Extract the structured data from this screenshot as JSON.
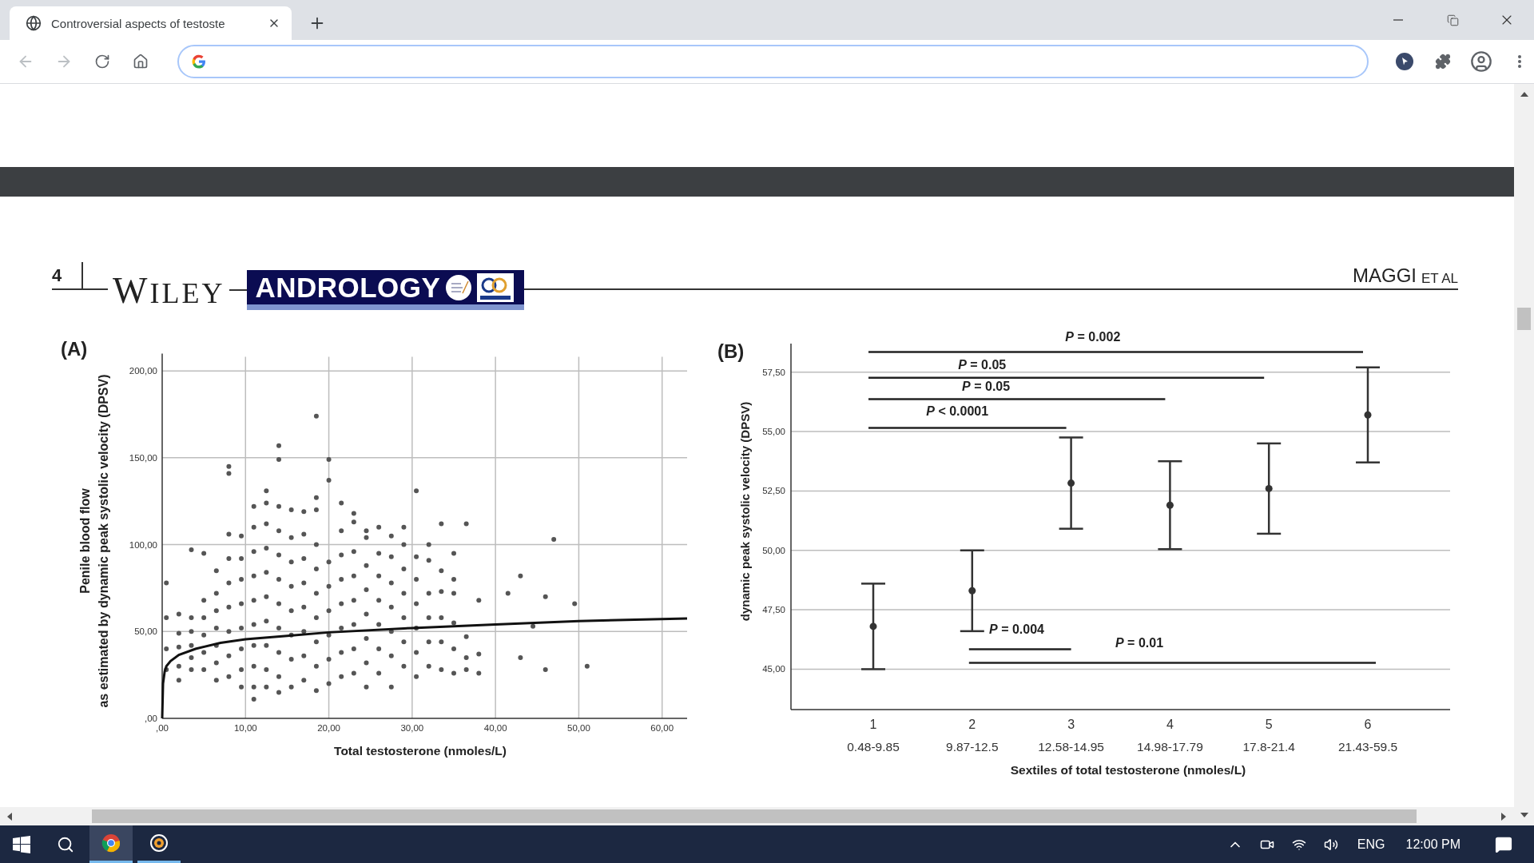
{
  "browser": {
    "tabs": [
      {
        "title": "Controversial aspects of testoste",
        "selected": true
      }
    ],
    "address_bar": {
      "focused": true
    }
  },
  "page": {
    "page_number": "4",
    "publisher": "WILEY",
    "journal": "ANDROLOGY",
    "author": "MAGGI",
    "author_suffix": "ET AL",
    "figures": [
      {
        "panel": "(A)",
        "chart_data": {
          "type": "scatter",
          "xlabel": "Total testosterone (nmoles/L)",
          "ylabel": [
            "Penile blood flow",
            "as estimated by dynamic peak systolic velocity (DPSV)"
          ],
          "xlim": [
            0,
            63
          ],
          "ylim": [
            0,
            210
          ],
          "grid": true,
          "xticks": [
            {
              "value": 0,
              "label": ",00"
            },
            {
              "value": 10,
              "label": "10,00"
            },
            {
              "value": 20,
              "label": "20,00"
            },
            {
              "value": 30,
              "label": "30,00"
            },
            {
              "value": 40,
              "label": "40,00"
            },
            {
              "value": 50,
              "label": "50,00"
            },
            {
              "value": 60,
              "label": "60,00"
            }
          ],
          "yticks": [
            {
              "value": 0,
              "label": ",00"
            },
            {
              "value": 50,
              "label": "50,00"
            },
            {
              "value": 100,
              "label": "100,00"
            },
            {
              "value": 150,
              "label": "150,00"
            },
            {
              "value": 200,
              "label": "200,00"
            }
          ],
          "x": [
            0.5,
            0.5,
            0.5,
            0.5,
            2,
            2,
            2,
            2,
            2,
            3.5,
            3.5,
            3.5,
            3.5,
            3.5,
            3.5,
            5,
            5,
            5,
            5,
            5,
            5,
            6.5,
            6.5,
            6.5,
            6.5,
            6.5,
            6.5,
            6.5,
            8,
            8,
            8,
            8,
            8,
            8,
            8,
            8,
            8,
            9.5,
            9.5,
            9.5,
            9.5,
            9.5,
            9.5,
            9.5,
            9.5,
            11,
            11,
            11,
            11,
            11,
            11,
            11,
            11,
            11,
            11,
            12.5,
            12.5,
            12.5,
            12.5,
            12.5,
            12.5,
            12.5,
            12.5,
            12.5,
            12.5,
            14,
            14,
            14,
            14,
            14,
            14,
            14,
            14,
            14,
            14,
            14,
            15.5,
            15.5,
            15.5,
            15.5,
            15.5,
            15.5,
            15.5,
            15.5,
            17,
            17,
            17,
            17,
            17,
            17,
            17,
            17,
            18.5,
            18.5,
            18.5,
            18.5,
            18.5,
            18.5,
            18.5,
            18.5,
            18.5,
            18.5,
            20,
            20,
            20,
            20,
            20,
            20,
            20,
            20,
            21.5,
            21.5,
            21.5,
            21.5,
            21.5,
            21.5,
            21.5,
            21.5,
            23,
            23,
            23,
            23,
            23,
            23,
            23,
            23,
            24.5,
            24.5,
            24.5,
            24.5,
            24.5,
            24.5,
            24.5,
            24.5,
            26,
            26,
            26,
            26,
            26,
            26,
            26,
            27.5,
            27.5,
            27.5,
            27.5,
            27.5,
            27.5,
            27.5,
            29,
            29,
            29,
            29,
            29,
            29,
            29,
            30.5,
            30.5,
            30.5,
            30.5,
            30.5,
            30.5,
            30.5,
            32,
            32,
            32,
            32,
            32,
            32,
            33.5,
            33.5,
            33.5,
            33.5,
            33.5,
            33.5,
            35,
            35,
            35,
            35,
            35,
            35,
            36.5,
            36.5,
            36.5,
            36.5,
            38,
            38,
            38,
            41.5,
            43,
            43,
            44.5,
            46,
            46,
            47,
            49.5,
            51
          ],
          "series": [
            {
              "color": "#555555",
              "values": [
                78,
                58,
                40,
                28,
                60,
                49,
                41,
                30,
                22,
                97,
                58,
                50,
                42,
                35,
                28,
                95,
                68,
                58,
                48,
                38,
                28,
                85,
                72,
                62,
                52,
                42,
                32,
                22,
                145,
                141,
                106,
                92,
                78,
                64,
                50,
                36,
                24,
                105,
                92,
                80,
                66,
                52,
                40,
                28,
                18,
                122,
                110,
                96,
                82,
                68,
                54,
                42,
                30,
                18,
                11,
                131,
                124,
                112,
                98,
                84,
                70,
                56,
                42,
                28,
                18,
                157,
                149,
                122,
                108,
                94,
                80,
                66,
                52,
                38,
                24,
                15,
                120,
                104,
                90,
                76,
                62,
                48,
                34,
                18,
                119,
                106,
                92,
                78,
                64,
                50,
                36,
                22,
                174,
                127,
                120,
                100,
                86,
                72,
                58,
                44,
                30,
                16,
                149,
                137,
                90,
                76,
                62,
                48,
                34,
                20,
                124,
                108,
                94,
                80,
                66,
                52,
                38,
                24,
                118,
                113,
                96,
                82,
                68,
                54,
                40,
                26,
                108,
                104,
                88,
                74,
                60,
                46,
                32,
                18,
                110,
                95,
                82,
                68,
                54,
                40,
                26,
                105,
                93,
                78,
                64,
                50,
                36,
                18,
                110,
                100,
                86,
                72,
                58,
                44,
                30,
                131,
                93,
                80,
                66,
                52,
                38,
                24,
                100,
                91,
                72,
                58,
                44,
                30,
                112,
                85,
                73,
                58,
                44,
                28,
                95,
                80,
                72,
                55,
                40,
                26,
                112,
                47,
                35,
                28,
                68,
                37,
                26,
                72,
                82,
                35,
                53,
                70,
                28,
                103,
                66,
                30
              ]
            }
          ]
        }
      },
      {
        "panel": "(B)",
        "category_ranges": [
          "0.48-9.85",
          "9.87-12.5",
          "12.58-14.95",
          "14.98-17.79",
          "17.8-21.4",
          "21.43-59.5"
        ],
        "comparisons": [
          {
            "label": "*P* = 0.002"
          },
          {
            "label": "*P* = 0.05"
          },
          {
            "label": "*P* = 0.05"
          },
          {
            "label": "*P* < 0.0001"
          },
          {
            "label": "*P* = 0.004"
          },
          {
            "label": "*P* = 0.01"
          }
        ],
        "chart_data": {
          "type": "scatter",
          "xlabel": "Sextiles of total testosterone (nmoles/L)",
          "ylabel": "dynamic peak systolic velocity (DPSV)",
          "grid": true,
          "categories": [
            "1",
            "2",
            "3",
            "4",
            "5",
            "6"
          ],
          "ylim": [
            43.3,
            58.7
          ],
          "yticks": [
            {
              "value": 45,
              "label": "45,00"
            },
            {
              "value": 47.5,
              "label": "47,50"
            },
            {
              "value": 50,
              "label": "50,00"
            },
            {
              "value": 52.5,
              "label": "52,50"
            },
            {
              "value": 55,
              "label": "55,00"
            },
            {
              "value": 57.5,
              "label": "57,50"
            }
          ],
          "series": [
            {
              "color": "#333333",
              "values": [
                46.8,
                48.3,
                52.83,
                51.9,
                52.6,
                55.7
              ],
              "errors": [
                1.8,
                1.7,
                1.92,
                1.85,
                1.9,
                2.0
              ]
            }
          ]
        }
      }
    ]
  },
  "taskbar": {
    "apps": [
      {
        "kind": "browser",
        "selected": true
      },
      {
        "kind": "disc",
        "selected": false
      }
    ],
    "language": "ENG",
    "time": "12:00 PM"
  }
}
